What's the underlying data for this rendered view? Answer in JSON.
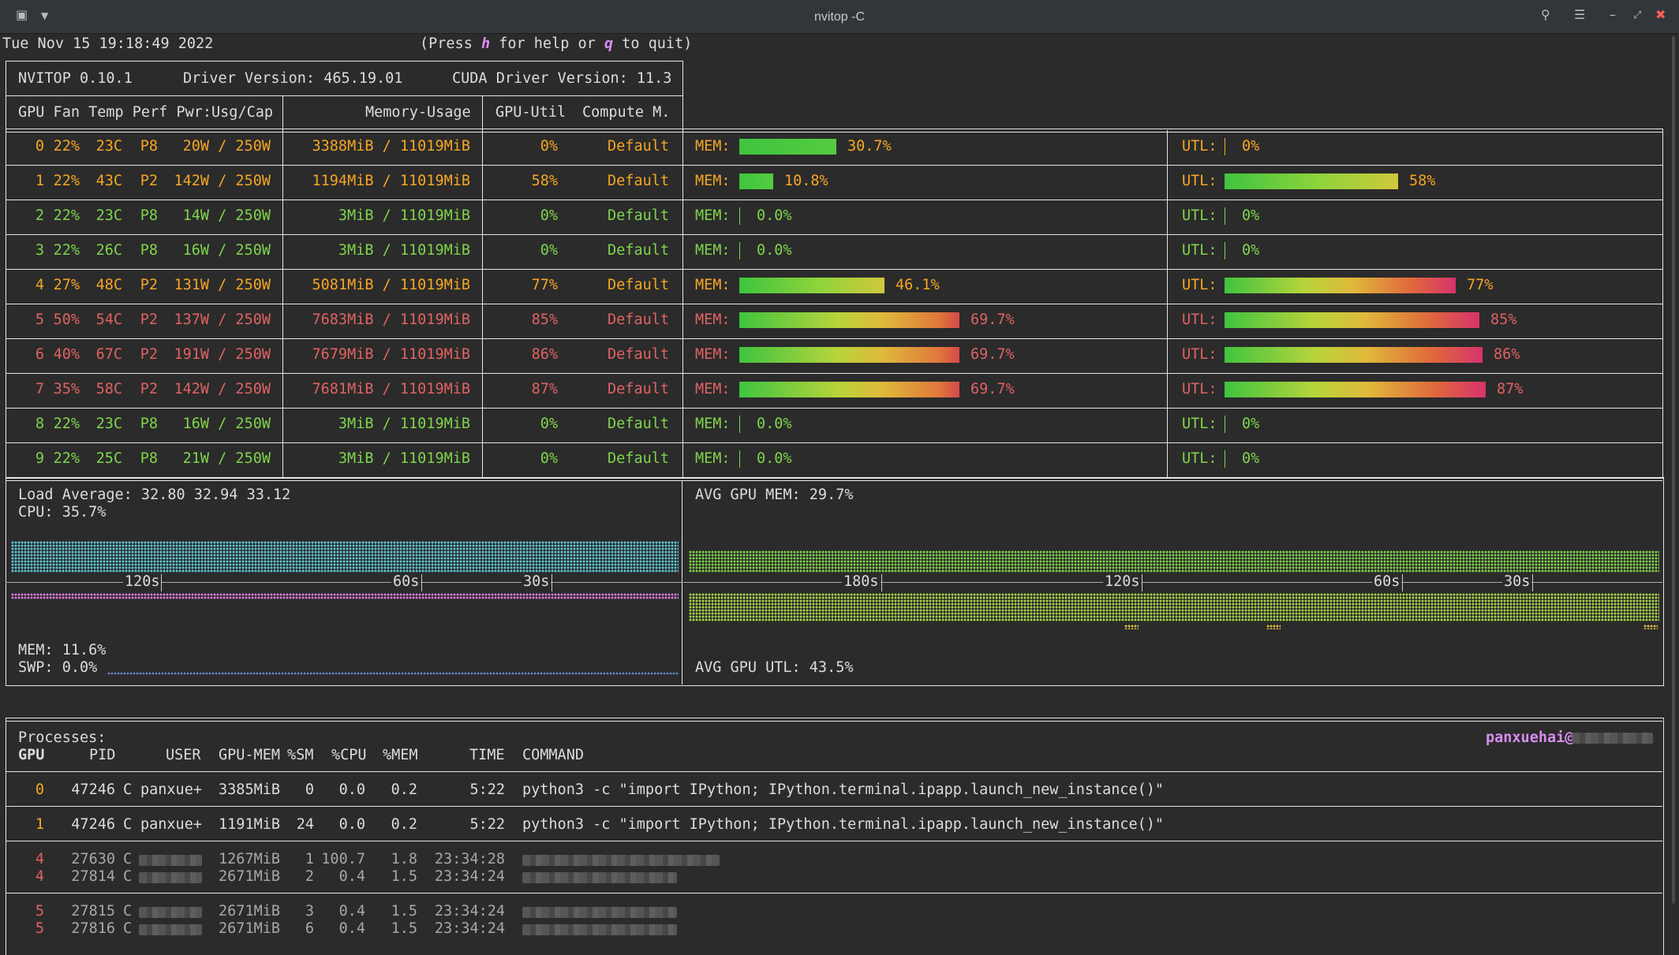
{
  "window": {
    "title": "nvitop -C"
  },
  "header": {
    "datetime": "Tue Nov 15 19:18:49 2022",
    "help_prefix": "(Press ",
    "help_key_h": "h",
    "help_middle": " for help or ",
    "help_key_q": "q",
    "help_suffix": " to quit)"
  },
  "summary": {
    "version": "NVITOP 0.10.1",
    "driver": "Driver Version: 465.19.01",
    "cuda": "CUDA Driver Version: 11.3",
    "col_left": "GPU Fan Temp Perf Pwr:Usg/Cap",
    "col_mem": "Memory-Usage",
    "col_util": "GPU-Util",
    "col_compute": "Compute M."
  },
  "gpus": [
    {
      "id": "0",
      "fan": "22%",
      "temp": "23C",
      "perf": "P8",
      "pwr": "20W / 250W",
      "mem": "3388MiB / 11019MiB",
      "util": "0%",
      "compute": "Default",
      "mem_pct": "30.7%",
      "mem_frac": 0.307,
      "utl_pct": "0%",
      "utl_frac": 0.0,
      "level": "orange"
    },
    {
      "id": "1",
      "fan": "22%",
      "temp": "43C",
      "perf": "P2",
      "pwr": "142W / 250W",
      "mem": "1194MiB / 11019MiB",
      "util": "58%",
      "compute": "Default",
      "mem_pct": "10.8%",
      "mem_frac": 0.108,
      "utl_pct": "58%",
      "utl_frac": 0.58,
      "level": "orange"
    },
    {
      "id": "2",
      "fan": "22%",
      "temp": "23C",
      "perf": "P8",
      "pwr": "14W / 250W",
      "mem": "3MiB / 11019MiB",
      "util": "0%",
      "compute": "Default",
      "mem_pct": "0.0%",
      "mem_frac": 0.0,
      "utl_pct": "0%",
      "utl_frac": 0.0,
      "level": "green"
    },
    {
      "id": "3",
      "fan": "22%",
      "temp": "26C",
      "perf": "P8",
      "pwr": "16W / 250W",
      "mem": "3MiB / 11019MiB",
      "util": "0%",
      "compute": "Default",
      "mem_pct": "0.0%",
      "mem_frac": 0.0,
      "utl_pct": "0%",
      "utl_frac": 0.0,
      "level": "green"
    },
    {
      "id": "4",
      "fan": "27%",
      "temp": "48C",
      "perf": "P2",
      "pwr": "131W / 250W",
      "mem": "5081MiB / 11019MiB",
      "util": "77%",
      "compute": "Default",
      "mem_pct": "46.1%",
      "mem_frac": 0.461,
      "utl_pct": "77%",
      "utl_frac": 0.77,
      "level": "orange"
    },
    {
      "id": "5",
      "fan": "50%",
      "temp": "54C",
      "perf": "P2",
      "pwr": "137W / 250W",
      "mem": "7683MiB / 11019MiB",
      "util": "85%",
      "compute": "Default",
      "mem_pct": "69.7%",
      "mem_frac": 0.697,
      "utl_pct": "85%",
      "utl_frac": 0.85,
      "level": "red"
    },
    {
      "id": "6",
      "fan": "40%",
      "temp": "67C",
      "perf": "P2",
      "pwr": "191W / 250W",
      "mem": "7679MiB / 11019MiB",
      "util": "86%",
      "compute": "Default",
      "mem_pct": "69.7%",
      "mem_frac": 0.697,
      "utl_pct": "86%",
      "utl_frac": 0.86,
      "level": "red"
    },
    {
      "id": "7",
      "fan": "35%",
      "temp": "58C",
      "perf": "P2",
      "pwr": "142W / 250W",
      "mem": "7681MiB / 11019MiB",
      "util": "87%",
      "compute": "Default",
      "mem_pct": "69.7%",
      "mem_frac": 0.697,
      "utl_pct": "87%",
      "utl_frac": 0.87,
      "level": "red"
    },
    {
      "id": "8",
      "fan": "22%",
      "temp": "23C",
      "perf": "P8",
      "pwr": "16W / 250W",
      "mem": "3MiB / 11019MiB",
      "util": "0%",
      "compute": "Default",
      "mem_pct": "0.0%",
      "mem_frac": 0.0,
      "utl_pct": "0%",
      "utl_frac": 0.0,
      "level": "green"
    },
    {
      "id": "9",
      "fan": "22%",
      "temp": "25C",
      "perf": "P8",
      "pwr": "21W / 250W",
      "mem": "3MiB / 11019MiB",
      "util": "0%",
      "compute": "Default",
      "mem_pct": "0.0%",
      "mem_frac": 0.0,
      "utl_pct": "0%",
      "utl_frac": 0.0,
      "level": "green"
    }
  ],
  "bar_labels": {
    "mem": "MEM:",
    "utl": "UTL:"
  },
  "host": {
    "load": "Load Average: 32.80 32.94 33.12",
    "cpu": "CPU: 35.7%",
    "mem": "MEM: 11.6%",
    "swp": "SWP: 0.0%",
    "ticks": [
      "120s",
      "60s",
      "30s"
    ]
  },
  "gpu_avg": {
    "mem": "AVG GPU MEM: 29.7%",
    "utl": "AVG GPU UTL: 43.5%",
    "ticks": [
      "180s",
      "120s",
      "60s",
      "30s"
    ]
  },
  "processes": {
    "title": "Processes:",
    "user_host": "panxuehai@",
    "headers": {
      "gpu": "GPU",
      "pid": "PID",
      "user": "USER",
      "gpumem": "GPU-MEM",
      "sm": "%SM",
      "cpu": "%CPU",
      "mem": "%MEM",
      "time": "TIME",
      "command": "COMMAND"
    },
    "rows": [
      {
        "gpu": "0",
        "pid": "47246",
        "type": "C",
        "user": "panxue+",
        "gpumem": "3385MiB",
        "sm": "0",
        "cpu": "0.0",
        "mem": "0.2",
        "time": "5:22",
        "command": "python3 -c \"import IPython; IPython.terminal.ipapp.launch_new_instance()\""
      },
      {
        "gpu": "1",
        "pid": "47246",
        "type": "C",
        "user": "panxue+",
        "gpumem": "1191MiB",
        "sm": "24",
        "cpu": "0.0",
        "mem": "0.2",
        "time": "5:22",
        "command": "python3 -c \"import IPython; IPython.terminal.ipapp.launch_new_instance()\""
      },
      {
        "gpu": "4",
        "pid": "27630",
        "type": "C",
        "user": "",
        "gpumem": "1267MiB",
        "sm": "1",
        "cpu": "100.7",
        "mem": "1.8",
        "time": "23:34:28",
        "command": ""
      },
      {
        "gpu": "4",
        "pid": "27814",
        "type": "C",
        "user": "",
        "gpumem": "2671MiB",
        "sm": "2",
        "cpu": "0.4",
        "mem": "1.5",
        "time": "23:34:24",
        "command": ""
      },
      {
        "gpu": "5",
        "pid": "27815",
        "type": "C",
        "user": "",
        "gpumem": "2671MiB",
        "sm": "3",
        "cpu": "0.4",
        "mem": "1.5",
        "time": "23:34:24",
        "command": ""
      },
      {
        "gpu": "5",
        "pid": "27816",
        "type": "C",
        "user": "",
        "gpumem": "2671MiB",
        "sm": "6",
        "cpu": "0.4",
        "mem": "1.5",
        "time": "23:34:24",
        "command": ""
      }
    ]
  },
  "colors": {
    "orange": "#f5a623",
    "green": "#7fd44b",
    "red": "#e06262",
    "cyan": "#5fc8d6",
    "pink": "#d67ad6",
    "border": "#e6e6e6"
  }
}
